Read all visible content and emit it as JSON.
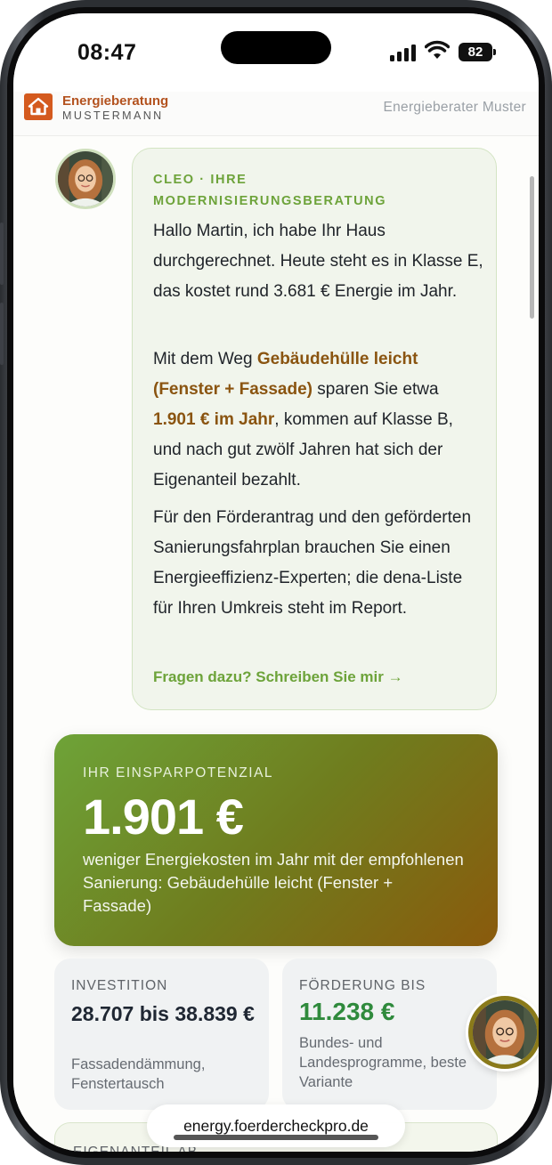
{
  "status_bar": {
    "time": "08:47",
    "battery": "82"
  },
  "header": {
    "brand_name": "Energieberatung",
    "brand_sub": "MUSTERMANN",
    "advisor": "Energieberater Muster"
  },
  "chat": {
    "label": "CLEO · IHRE MODERNISIERUNGSBERATUNG",
    "p1": "Hallo Martin, ich habe Ihr Haus durchgerechnet. Heute steht es in Klasse E, das kostet rund 3.681 € Energie im Jahr.",
    "p2_pre": "Mit dem Weg ",
    "p2_path": "Gebäudehülle leicht (Fenster + Fassade)",
    "p2_mid": " sparen Sie etwa ",
    "p2_amount": "1.901 € im Jahr",
    "p2_post": ", kommen auf Klasse B, und nach gut zwölf Jahren hat sich der Eigenanteil bezahlt.",
    "p3": "Für den Förderantrag und den geförderten Sanierungsfahrplan brauchen Sie einen Energieeffizienz-Experten; die dena-Liste für Ihren Umkreis steht im Report.",
    "link": "Fragen dazu? Schreiben Sie mir →"
  },
  "savings": {
    "label": "IHR EINSPARPOTENZIAL",
    "value": "1.901 €",
    "desc": "weniger Energiekosten im Jahr mit der empfohlenen Sanierung: Gebäudehülle leicht (Fenster + Fassade)"
  },
  "investment": {
    "label": "INVESTITION",
    "value": "28.707 bis 38.839 €",
    "desc": "Fassadendämmung, Fenstertausch"
  },
  "funding": {
    "label": "FÖRDERUNG BIS",
    "value": "11.238 €",
    "desc": "Bundes- und Landesprogramme, beste Variante"
  },
  "own_share": {
    "label": "EIGENANTEIL AB"
  },
  "browser": {
    "url": "energy.foerdercheckpro.de"
  },
  "colors": {
    "accent_green": "#6da33a",
    "highlight_brown": "#8a5410",
    "funding_green": "#2f8a3c",
    "brand_orange": "#d45a1e"
  },
  "icons": [
    "house-logo-icon",
    "signal-icon",
    "wifi-icon",
    "battery-icon",
    "advisor-avatar"
  ]
}
